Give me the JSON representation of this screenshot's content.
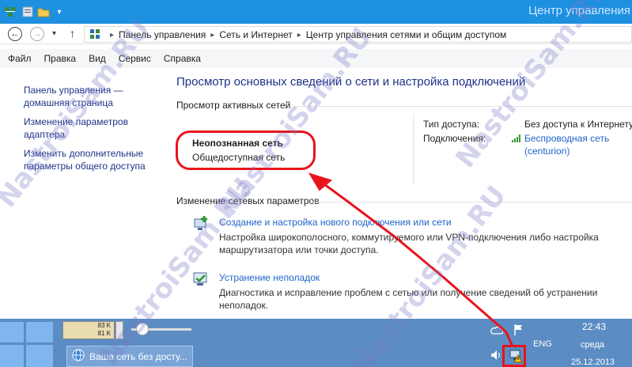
{
  "window": {
    "title": "Центр управления"
  },
  "address_bar": {
    "crumbs": [
      "Панель управления",
      "Сеть и Интернет",
      "Центр управления сетями и общим доступом"
    ]
  },
  "menu": [
    "Файл",
    "Правка",
    "Вид",
    "Сервис",
    "Справка"
  ],
  "left_nav": [
    "Панель управления — домашняя страница",
    "Изменение параметров адаптера",
    "Изменить дополнительные параметры общего доступа"
  ],
  "main": {
    "title": "Просмотр основных сведений о сети и настройка подключений",
    "active_networks_header": "Просмотр активных сетей",
    "network_name": "Неопознанная сеть",
    "network_type": "Общедоступная сеть",
    "access_type_label": "Тип доступа:",
    "access_type_value": "Без доступа к Интернету",
    "connections_label": "Подключения:",
    "connection_value_line1": "Беспроводная сеть",
    "connection_value_line2": "(centurion)",
    "change_settings_header": "Изменение сетевых параметров",
    "task1_link": "Создание и настройка нового подключения или сети",
    "task1_desc": "Настройка широкополосного, коммутируемого или VPN-подключения либо настройка маршрутизатора или точки доступа.",
    "task2_link": "Устранение неполадок",
    "task2_desc": "Диагностика и исправление проблем с сетью или получение сведений об устранении неполадок."
  },
  "taskbar": {
    "meter_up": "83 K",
    "meter_down": "81 K",
    "task_button": "Ваша сеть без досту...",
    "lang": "ENG",
    "time": "22:43",
    "day": "среда",
    "date": "25.12.2013"
  },
  "watermark": "NastroiSam.RU",
  "colors": {
    "titlebar": "#1e90e0",
    "taskbar": "#5b8cc3",
    "link": "#1e64c8",
    "annotation_red": "#e8141c"
  }
}
